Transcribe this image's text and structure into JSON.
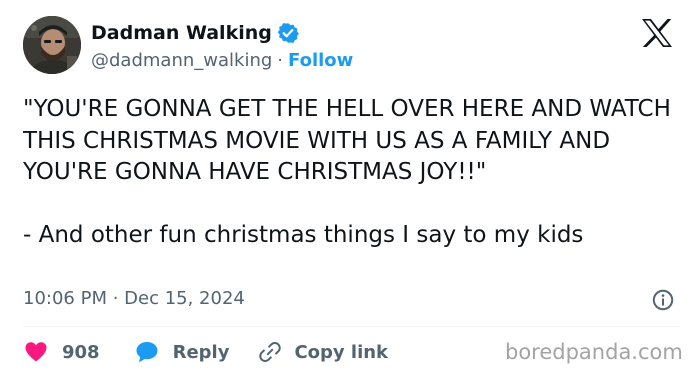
{
  "author": {
    "display_name": "Dadman Walking",
    "handle": "@dadmann_walking",
    "separator": "·",
    "follow_label": "Follow",
    "verified": true,
    "avatar_icon": "profile-photo"
  },
  "tweet": {
    "text": "\"YOU'RE GONNA GET THE HELL OVER HERE AND WATCH THIS CHRISTMAS MOVIE WITH US AS A FAMILY AND YOU'RE GONNA HAVE CHRISTMAS JOY!!\"\n\n- And other fun christmas things I say to my kids",
    "timestamp": "10:06 PM · Dec 15, 2024"
  },
  "actions": {
    "like_count": "908",
    "reply_label": "Reply",
    "copy_link_label": "Copy link"
  },
  "watermark": "boredpanda.com",
  "icons": {
    "verified": "verified-badge-icon",
    "platform": "x-logo-icon",
    "info": "info-icon",
    "like": "heart-icon",
    "reply": "speech-bubble-icon",
    "copy": "link-icon"
  },
  "colors": {
    "text": "#0f1419",
    "secondary": "#536471",
    "accent": "#1d9bf0",
    "like": "#f91880",
    "divider": "#eff3f4",
    "watermark": "#a3a3a3"
  }
}
